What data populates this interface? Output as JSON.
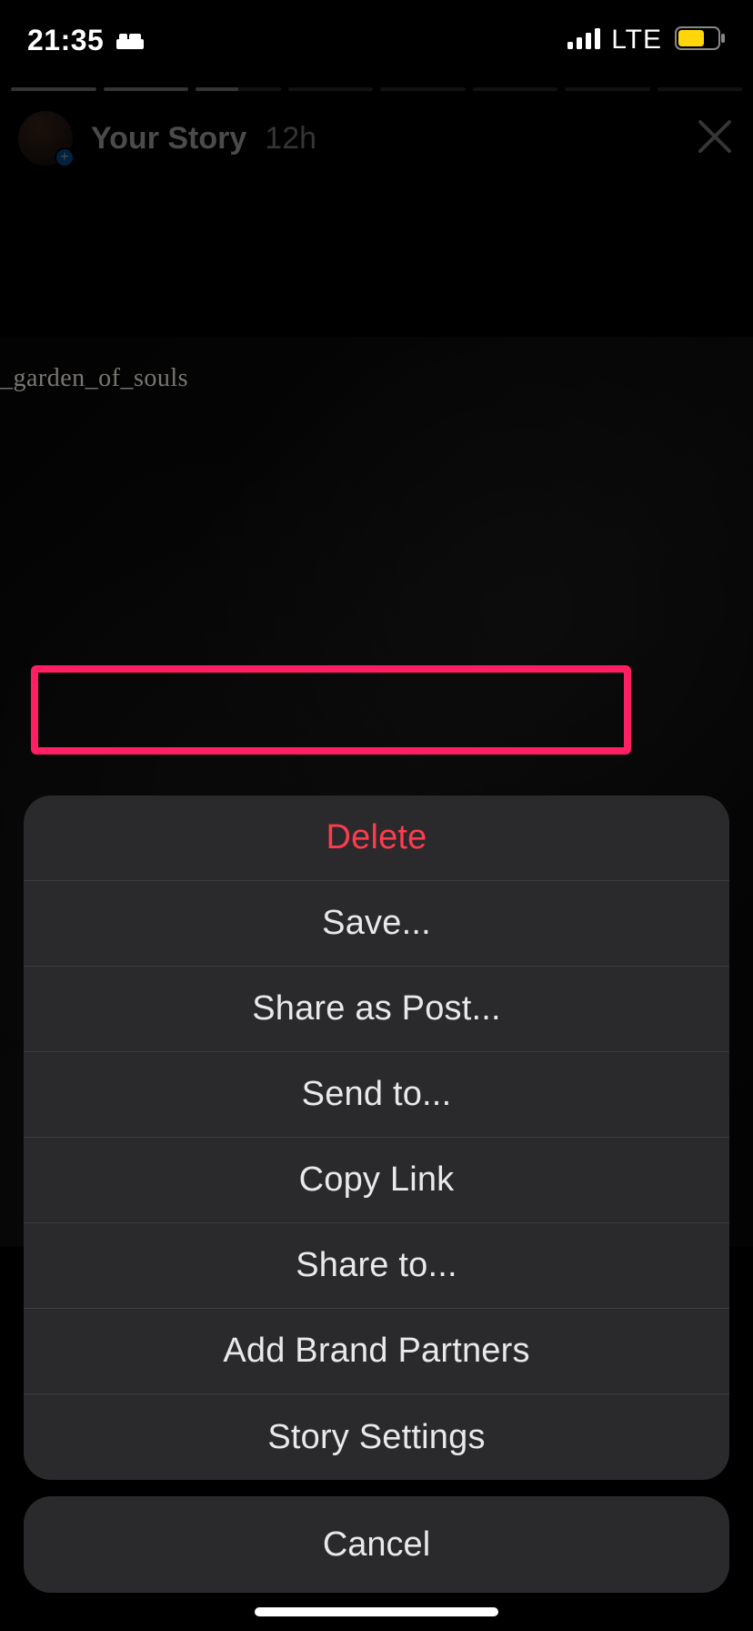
{
  "status": {
    "time": "21:35",
    "network": "LTE"
  },
  "story": {
    "title": "Your Story",
    "time": "12h",
    "tag": "_garden_of_souls"
  },
  "sheet": {
    "delete": "Delete",
    "save": "Save...",
    "share_post": "Share as Post...",
    "send_to": "Send to...",
    "copy_link": "Copy Link",
    "share_to": "Share to...",
    "brand_partners": "Add Brand Partners",
    "story_settings": "Story Settings",
    "cancel": "Cancel"
  },
  "annotation": {
    "highlighted_option": "save"
  }
}
